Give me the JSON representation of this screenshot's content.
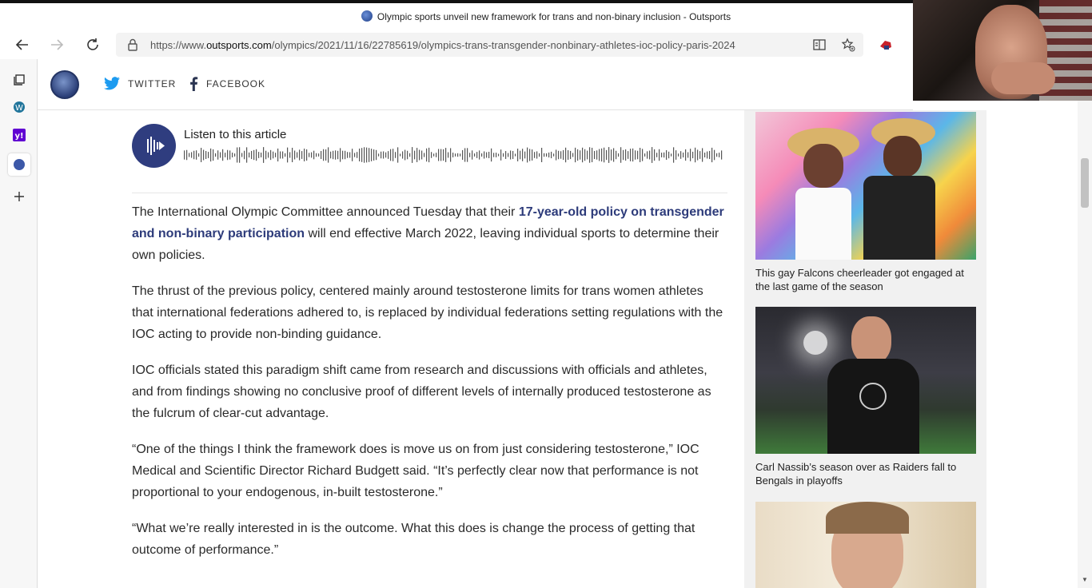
{
  "window": {
    "title": "Olympic sports unveil new framework for trans and non-binary inclusion - Outsports"
  },
  "navbar": {
    "url_prefix": "https://www.",
    "url_domain": "outsports.com",
    "url_path": "/olympics/2021/11/16/22785619/olympics-trans-transgender-nonbinary-athletes-ioc-policy-paris-2024"
  },
  "header": {
    "twitter_label": "TWITTER",
    "facebook_label": "FACEBOOK"
  },
  "player": {
    "label": "Listen to this article"
  },
  "article": {
    "p1_before": "The International Olympic Committee announced Tuesday that their ",
    "p1_link": "17-year-old policy on transgender and non-binary participation",
    "p1_after": " will end effective March 2022, leaving individual sports to determine their own policies.",
    "p2": "The thrust of the previous policy, centered mainly around testosterone limits for trans women athletes that international federations adhered to, is replaced by individual federations setting regulations with the IOC acting to provide non-binding guidance.",
    "p3": "IOC officials stated this paradigm shift came from research and discussions with officials and athletes, and from findings showing no conclusive proof of different levels of internally produced testosterone as the fulcrum of clear-cut advantage.",
    "p4": "“One of the things I think the framework does is move us on from just considering testosterone,” IOC Medical and Scientific Director Richard Budgett said. “It’s perfectly clear now that performance is not proportional to your endogenous, in-built testosterone.”",
    "p5": "“What we’re really interested in is the outcome. What this does is change the process of getting that outcome of performance.”"
  },
  "rail": {
    "cards": [
      {
        "caption": "This gay Falcons cheerleader got engaged at the last game of the season"
      },
      {
        "caption": "Carl Nassib’s season over as Raiders fall to Bengals in playoffs"
      }
    ]
  },
  "colors": {
    "brand": "#2d3b7a",
    "twitter": "#1d9bf0"
  }
}
